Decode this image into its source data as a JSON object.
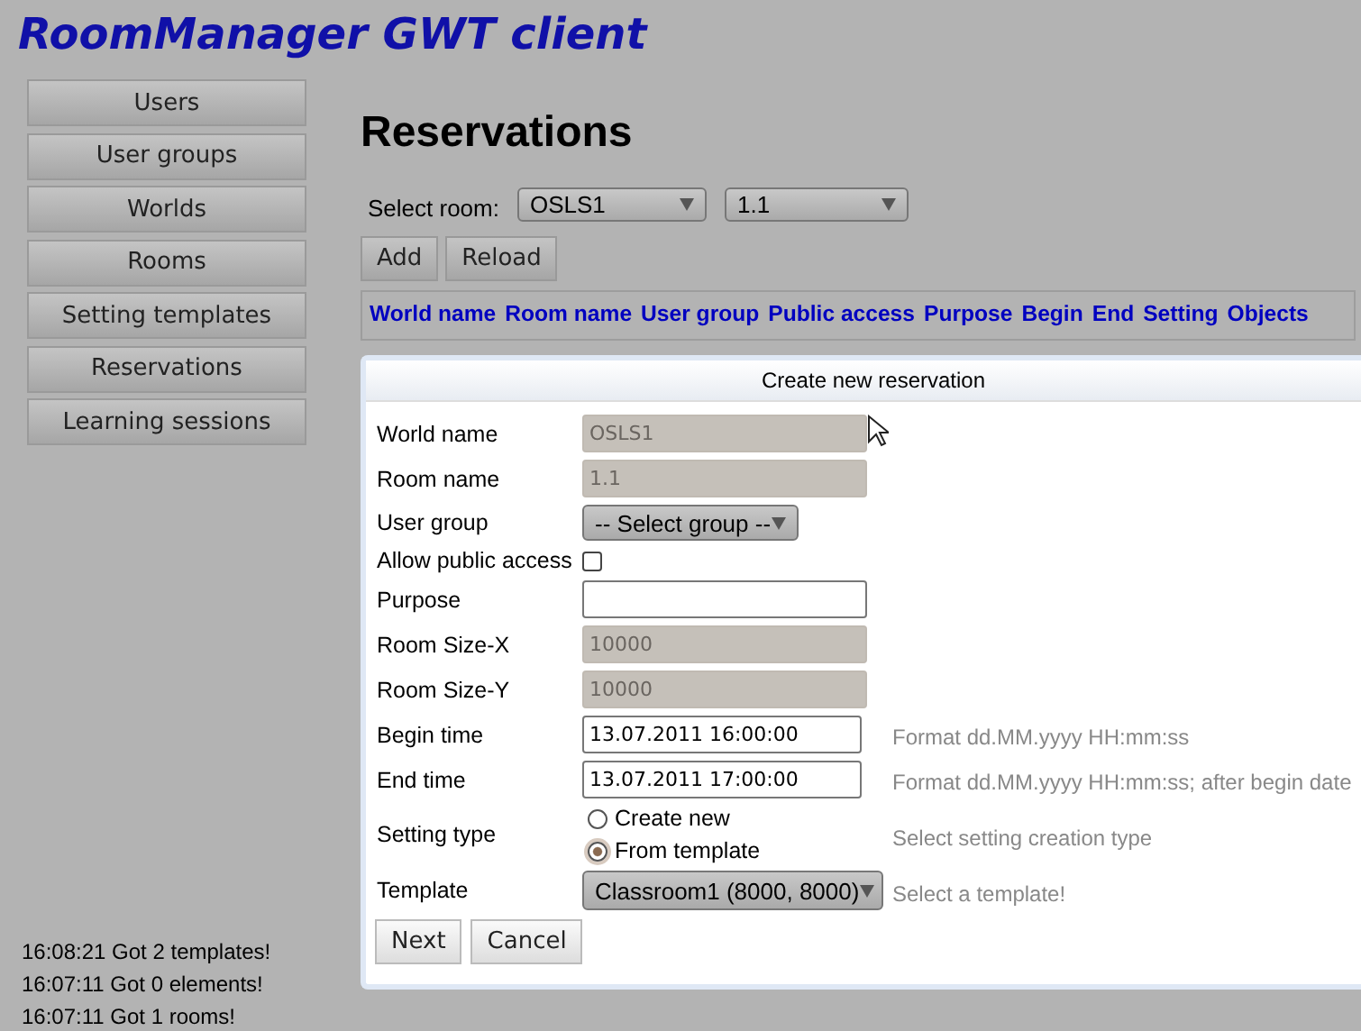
{
  "app_title": "RoomManager GWT client",
  "nav": [
    {
      "label": "Users"
    },
    {
      "label": "User groups"
    },
    {
      "label": "Worlds"
    },
    {
      "label": "Rooms"
    },
    {
      "label": "Setting templates"
    },
    {
      "label": "Reservations"
    },
    {
      "label": "Learning sessions"
    }
  ],
  "log": [
    "16:08:21 Got 2 templates!",
    "16:07:11 Got 0 elements!",
    "16:07:11 Got 1 rooms!"
  ],
  "heading": "Reservations",
  "room_select": {
    "label": "Select room:",
    "world": "OSLS1",
    "room": "1.1"
  },
  "buttons": [
    "Add",
    "Reload"
  ],
  "table": {
    "columns": [
      "World name",
      "Room name",
      "User group",
      "Public access",
      "Purpose",
      "Begin",
      "End",
      "Setting",
      "Objects"
    ]
  },
  "dialog": {
    "title": "Create new reservation",
    "fields": [
      {
        "kind": "text",
        "label": "World name",
        "value": "OSLS1",
        "disabled": true
      },
      {
        "kind": "text",
        "label": "Room name",
        "value": "1.1",
        "disabled": true
      },
      {
        "kind": "select",
        "label": "User group",
        "value": "-- Select group --"
      },
      {
        "kind": "checkbox",
        "label": "Allow public access",
        "checked": false
      },
      {
        "kind": "text",
        "label": "Purpose",
        "disabled": false
      },
      {
        "kind": "text",
        "label": "Room Size-X",
        "value": "10000",
        "disabled": true
      },
      {
        "kind": "text",
        "label": "Room Size-Y",
        "value": "10000",
        "disabled": true
      },
      {
        "kind": "text",
        "label": "Begin time",
        "value": "13.07.2011 16:00:00",
        "disabled": false,
        "hint": "Format dd.MM.yyyy HH:mm:ss"
      },
      {
        "kind": "text",
        "label": "End time",
        "value": "13.07.2011 17:00:00",
        "disabled": false,
        "hint": "Format dd.MM.yyyy HH:mm:ss; after begin date"
      },
      {
        "kind": "radio",
        "label": "Setting type",
        "options": [
          {
            "label": "Create new",
            "selected": false
          },
          {
            "label": "From template",
            "selected": true
          }
        ],
        "hint": "Select setting creation type"
      },
      {
        "kind": "select",
        "label": "Template",
        "value": "Classroom1 (8000, 8000)",
        "hint": "Select a template!"
      }
    ],
    "buttons": [
      "Next",
      "Cancel"
    ]
  }
}
